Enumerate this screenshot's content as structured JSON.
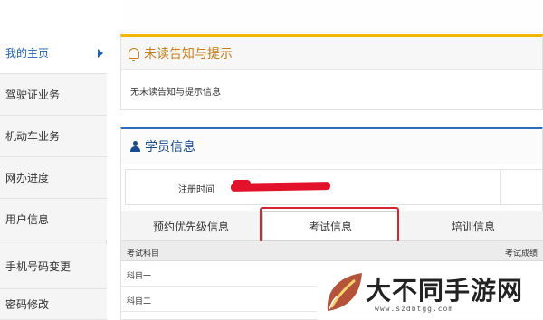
{
  "sidebar": {
    "items": [
      {
        "label": "我的主页",
        "active": true
      },
      {
        "label": "驾驶证业务",
        "active": false
      },
      {
        "label": "机动车业务",
        "active": false
      },
      {
        "label": "网办进度",
        "active": false
      },
      {
        "label": "用户信息",
        "active": false
      },
      {
        "label": "手机号码变更",
        "active": false
      },
      {
        "label": "密码修改",
        "active": false
      }
    ]
  },
  "notice": {
    "title": "未读告知与提示",
    "message": "无未读告知与提示信息"
  },
  "student": {
    "title": "学员信息",
    "reg_label": "注册时间"
  },
  "tabs": [
    {
      "label": "预约优先级信息"
    },
    {
      "label": "考试信息",
      "selected": true
    },
    {
      "label": "培训信息"
    }
  ],
  "exam_table": {
    "headers": [
      "考试科目",
      "考试成绩"
    ],
    "rows": [
      {
        "subject": "科目一"
      },
      {
        "subject": "科目二"
      }
    ]
  },
  "watermark": {
    "title": "大不同手游网",
    "url": "www.szdbtgg.com"
  },
  "colors": {
    "accent_notice": "#f2b600",
    "accent_student": "#2a6db8",
    "highlight": "#d9252f",
    "redaction": "#e3122b"
  }
}
